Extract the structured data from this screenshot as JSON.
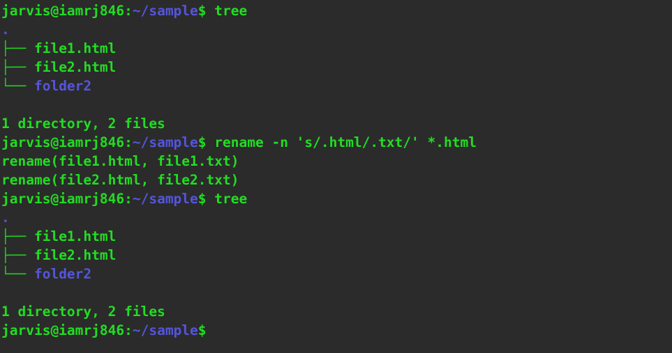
{
  "terminal": {
    "title": "jarvis@iamrj846: ~/sample",
    "colors": {
      "background": "#2b2b2b",
      "green": "#22dd22",
      "blue": "#5555dd",
      "tree_branch": "#22cc22"
    },
    "prompt": {
      "user_host": "jarvis@iamrj846",
      "separator": ":",
      "path": "~/sample",
      "sigil": "$"
    },
    "lines": [
      {
        "type": "prompt",
        "user_host": "jarvis@iamrj846",
        "separator": ":",
        "path": "~/sample",
        "sigil": "$",
        "command": " tree"
      },
      {
        "type": "tree-root",
        "text": "."
      },
      {
        "type": "tree-entry",
        "branch": "├── ",
        "name": "file1.html",
        "kind": "file"
      },
      {
        "type": "tree-entry",
        "branch": "├── ",
        "name": "file2.html",
        "kind": "file"
      },
      {
        "type": "tree-entry",
        "branch": "└── ",
        "name": "folder2",
        "kind": "dir"
      },
      {
        "type": "blank",
        "text": ""
      },
      {
        "type": "output",
        "text": "1 directory, 2 files"
      },
      {
        "type": "prompt",
        "user_host": "jarvis@iamrj846",
        "separator": ":",
        "path": "~/sample",
        "sigil": "$",
        "command": " rename -n 's/.html/.txt/' *.html"
      },
      {
        "type": "output",
        "text": "rename(file1.html, file1.txt)"
      },
      {
        "type": "output",
        "text": "rename(file2.html, file2.txt)"
      },
      {
        "type": "prompt",
        "user_host": "jarvis@iamrj846",
        "separator": ":",
        "path": "~/sample",
        "sigil": "$",
        "command": " tree"
      },
      {
        "type": "tree-root",
        "text": "."
      },
      {
        "type": "tree-entry",
        "branch": "├── ",
        "name": "file1.html",
        "kind": "file"
      },
      {
        "type": "tree-entry",
        "branch": "├── ",
        "name": "file2.html",
        "kind": "file"
      },
      {
        "type": "tree-entry",
        "branch": "└── ",
        "name": "folder2",
        "kind": "dir"
      },
      {
        "type": "blank",
        "text": ""
      },
      {
        "type": "output",
        "text": "1 directory, 2 files"
      },
      {
        "type": "prompt",
        "user_host": "jarvis@iamrj846",
        "separator": ":",
        "path": "~/sample",
        "sigil": "$",
        "command": ""
      }
    ]
  }
}
